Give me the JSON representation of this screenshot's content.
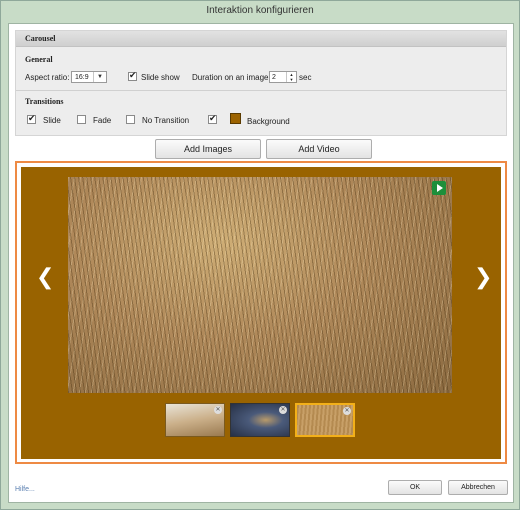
{
  "window": {
    "title": "Interaktion konfigurieren"
  },
  "panel": {
    "section_title": "Carousel",
    "general": {
      "heading": "General",
      "aspect_label": "Aspect ratio:",
      "aspect_value": "16:9",
      "slideshow_label": "Slide show",
      "slideshow_checked": true,
      "duration_label": "Duration on an image",
      "duration_value": "2",
      "duration_unit": "sec"
    },
    "transitions": {
      "heading": "Transitions",
      "slide_label": "Slide",
      "slide_checked": true,
      "fade_label": "Fade",
      "fade_checked": false,
      "none_label": "No Transition",
      "none_checked": false,
      "background_label": "Background",
      "background_checked": true,
      "background_color": "#9c6300"
    }
  },
  "buttons": {
    "add_images": "Add Images",
    "add_video": "Add Video"
  },
  "preview": {
    "stage_color": "#996300",
    "prev_icon": "chevron-left-icon",
    "next_icon": "chevron-right-icon",
    "play_icon": "play-icon",
    "thumbnails": [
      {
        "name": "thumbnail-1",
        "selected": false
      },
      {
        "name": "thumbnail-2",
        "selected": false
      },
      {
        "name": "thumbnail-3",
        "selected": true
      }
    ]
  },
  "footer": {
    "help": "Hilfe...",
    "ok": "OK",
    "cancel": "Abbrechen"
  },
  "colors": {
    "accent_border": "#ee8a44",
    "selected_thumb_border": "#f3b019",
    "play_badge": "#1d8f3a"
  }
}
